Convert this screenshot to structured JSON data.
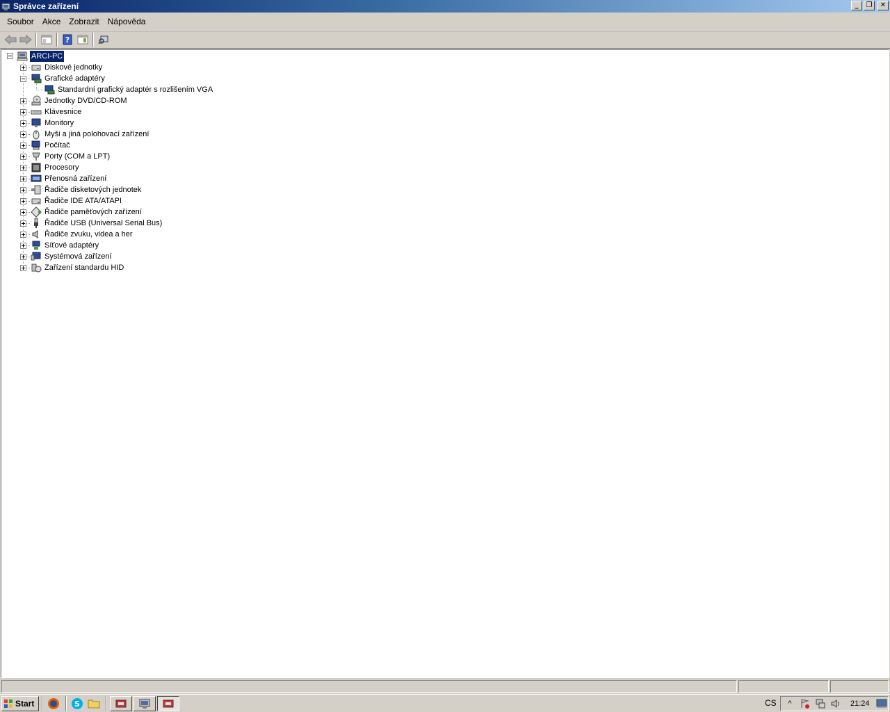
{
  "window": {
    "title": "Správce zařízení",
    "minimize": "_",
    "maximize": "❐",
    "close": "✕"
  },
  "menu": [
    "Soubor",
    "Akce",
    "Zobrazit",
    "Nápověda"
  ],
  "tree": {
    "root": "ARCI-PC",
    "categories": [
      {
        "label": "Diskové jednotky",
        "icon": "disk-drive-icon",
        "expanded": false
      },
      {
        "label": "Grafické adaptéry",
        "icon": "display-adapter-icon",
        "expanded": true,
        "children": [
          "Standardní grafický adaptér s rozlišením VGA"
        ]
      },
      {
        "label": "Jednotky DVD/CD-ROM",
        "icon": "dvd-drive-icon",
        "expanded": false
      },
      {
        "label": "Klávesnice",
        "icon": "keyboard-icon",
        "expanded": false
      },
      {
        "label": "Monitory",
        "icon": "monitor-icon",
        "expanded": false
      },
      {
        "label": "Myši a jiná polohovací zařízení",
        "icon": "mouse-icon",
        "expanded": false
      },
      {
        "label": "Počítač",
        "icon": "computer-icon",
        "expanded": false
      },
      {
        "label": "Porty (COM a LPT)",
        "icon": "port-icon",
        "expanded": false
      },
      {
        "label": "Procesory",
        "icon": "processor-icon",
        "expanded": false
      },
      {
        "label": "Přenosná zařízení",
        "icon": "portable-device-icon",
        "expanded": false
      },
      {
        "label": "Řadiče disketových jednotek",
        "icon": "floppy-controller-icon",
        "expanded": false
      },
      {
        "label": "Řadiče IDE ATA/ATAPI",
        "icon": "ide-controller-icon",
        "expanded": false
      },
      {
        "label": "Řadiče paměťových zařízení",
        "icon": "storage-controller-icon",
        "expanded": false
      },
      {
        "label": "Řadiče USB (Universal Serial Bus)",
        "icon": "usb-icon",
        "expanded": false
      },
      {
        "label": "Řadiče zvuku, videa a her",
        "icon": "speaker-icon",
        "expanded": false
      },
      {
        "label": "Síťové adaptéry",
        "icon": "network-adapter-icon",
        "expanded": false
      },
      {
        "label": "Systémová zařízení",
        "icon": "system-device-icon",
        "expanded": false
      },
      {
        "label": "Zařízení standardu HID",
        "icon": "hid-icon",
        "expanded": false
      }
    ]
  },
  "taskbar": {
    "start_label": "Start",
    "language": "CS",
    "clock": "21:24",
    "show_hidden": "^"
  },
  "colors": {
    "title_active": "#0a246a",
    "selection": "#0a246a",
    "face": "#d4d0c8"
  }
}
